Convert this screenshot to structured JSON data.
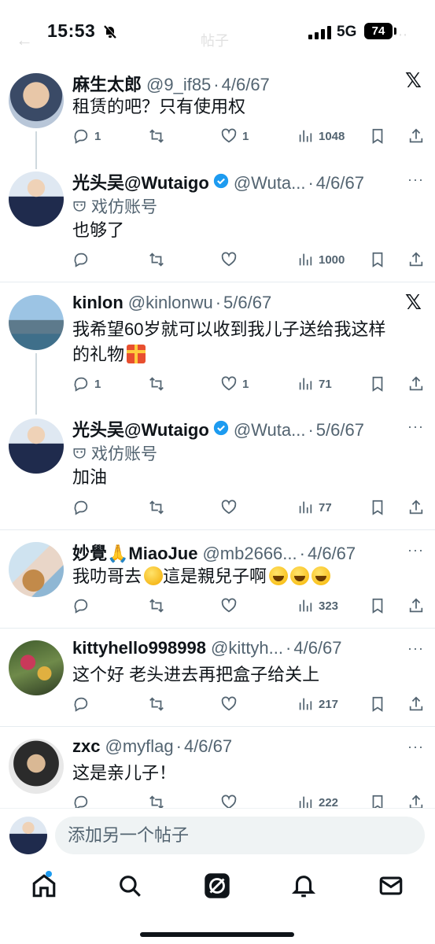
{
  "status_bar": {
    "time": "15:53",
    "network": "5G",
    "battery": "74",
    "page_title": "帖子"
  },
  "posts": [
    {
      "name": "麻生太郎",
      "handle": "@9_if85",
      "date": "4/6/67",
      "text": "租赁的吧？只有使用权",
      "replies": "1",
      "reposts": "",
      "likes": "1",
      "views": "1048",
      "corner_icon": "x-logo-icon"
    },
    {
      "name": "光头吴@Wutaigo",
      "handle": "@Wuta...",
      "date": "4/6/67",
      "label": "戏仿账号",
      "text": "也够了",
      "replies": "",
      "reposts": "",
      "likes": "",
      "views": "1000",
      "verified": true
    },
    {
      "name": "kinlon",
      "handle": "@kinlonwu",
      "date": "5/6/67",
      "text_line1": "我希望60岁就可以收到我儿子送给我这样",
      "text_line2": "的礼物",
      "replies": "1",
      "reposts": "",
      "likes": "1",
      "views": "71",
      "corner_icon": "x-logo-icon"
    },
    {
      "name": "光头吴@Wutaigo",
      "handle": "@Wuta...",
      "date": "5/6/67",
      "label": "戏仿账号",
      "text": "加油",
      "replies": "",
      "reposts": "",
      "likes": "",
      "views": "77",
      "verified": true
    },
    {
      "name_a": "妙覺",
      "name_b": "MiaoJue",
      "handle": "@mb2666...",
      "date": "4/6/67",
      "text_a": "我叻哥去",
      "text_b": "這是親兒子啊",
      "replies": "",
      "reposts": "",
      "likes": "",
      "views": "323"
    },
    {
      "name": "kittyhello998998",
      "handle": "@kittyh...",
      "date": "4/6/67",
      "text": "这个好 老头进去再把盒子给关上",
      "replies": "",
      "reposts": "",
      "likes": "",
      "views": "217"
    },
    {
      "name": "zxc",
      "handle": "@myflag",
      "date": "4/6/67",
      "text": "这是亲儿子！",
      "replies": "",
      "reposts": "",
      "likes": "",
      "views": "222"
    }
  ],
  "composer": {
    "placeholder": "添加另一个帖子"
  },
  "tabbar": {
    "items": [
      "home-icon",
      "search-icon",
      "grok-icon",
      "notifications-icon",
      "messages-icon"
    ]
  },
  "colors": {
    "text": "#0f1419",
    "muted": "#536471",
    "verified_blue": "#1d9bf0",
    "divider": "#e6ecf0"
  }
}
